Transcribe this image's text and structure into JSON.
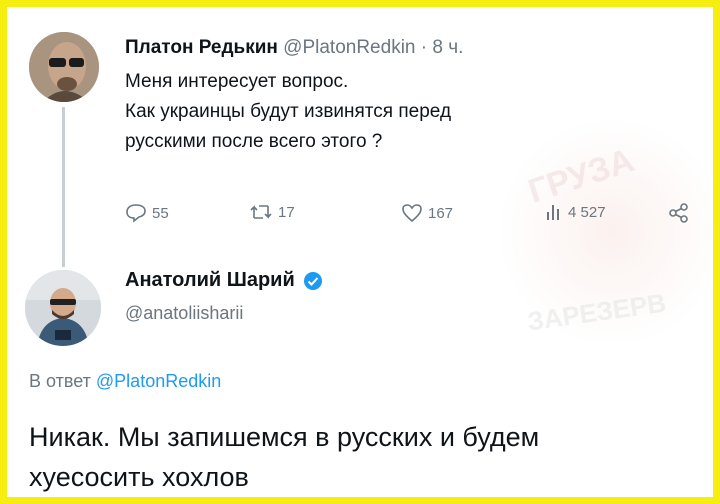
{
  "tweet1": {
    "name": "Платон Редькин",
    "handle": "@PlatonRedkin",
    "time": "· 8 ч.",
    "lines": [
      "Меня интересует вопрос.",
      "Как украинцы будут извинятся перед",
      "русскими после всего этого ?"
    ],
    "stats": {
      "replies": "55",
      "retweets": "17",
      "likes": "167",
      "views": "4 527"
    }
  },
  "tweet2": {
    "name": "Анатолий Шарий",
    "handle": "@anatoliisharii",
    "reply_prefix": "В ответ",
    "reply_mention": "@PlatonRedkin",
    "lines": [
      "Никак. Мы запишемся в русских и будем",
      "хуесосить хохлов"
    ]
  },
  "watermark": {
    "text1": "ГРУЗА",
    "text2": "ЗАРЕЗЕРВ"
  },
  "colors": {
    "border": "#f5ee10",
    "link": "#1d9bf0",
    "muted": "#6b7680",
    "verified": "#1d9bf0"
  },
  "icons": [
    "reply-icon",
    "retweet-icon",
    "like-icon",
    "views-icon",
    "share-icon",
    "verified-badge-icon"
  ]
}
